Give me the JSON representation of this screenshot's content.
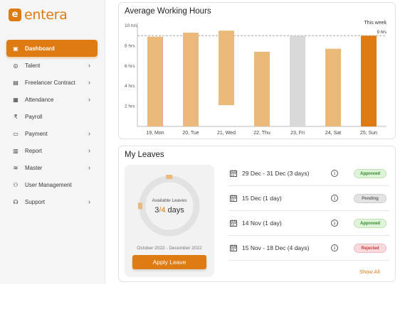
{
  "brand": {
    "name": "entera",
    "mark": "e",
    "accent": "#de7b12"
  },
  "sidebar": {
    "items": [
      {
        "label": "Dashboard",
        "icon": "dashboard-icon",
        "glyph": "▣",
        "active": true,
        "chevron": false
      },
      {
        "label": "Talent",
        "icon": "talent-icon",
        "glyph": "◎",
        "active": false,
        "chevron": true
      },
      {
        "label": "Freelancer Contract",
        "icon": "contract-icon",
        "glyph": "▤",
        "active": false,
        "chevron": true
      },
      {
        "label": "Attendance",
        "icon": "attendance-icon",
        "glyph": "▦",
        "active": false,
        "chevron": true
      },
      {
        "label": "Payroll",
        "icon": "rupee-icon",
        "glyph": "₹",
        "active": false,
        "chevron": false
      },
      {
        "label": "Payment",
        "icon": "payment-icon",
        "glyph": "▭",
        "active": false,
        "chevron": true
      },
      {
        "label": "Report",
        "icon": "report-icon",
        "glyph": "▥",
        "active": false,
        "chevron": true
      },
      {
        "label": "Master",
        "icon": "database-icon",
        "glyph": "≋",
        "active": false,
        "chevron": true
      },
      {
        "label": "User Management",
        "icon": "users-icon",
        "glyph": "⚇",
        "active": false,
        "chevron": false
      },
      {
        "label": "Support",
        "icon": "support-icon",
        "glyph": "☊",
        "active": false,
        "chevron": true
      }
    ],
    "chevron_glyph": "›"
  },
  "working_hours": {
    "title": "Average Working Hours",
    "this_week_label": "This week",
    "target_label": "9 hrs"
  },
  "chart_data": {
    "type": "bar",
    "title": "Average Working Hours",
    "categories": [
      "19, Mon",
      "20, Tue",
      "21, Wed",
      "22, Thu",
      "23, Fri",
      "24, Sat",
      "25, Sun"
    ],
    "series": [
      {
        "values": [
          {
            "start": 0,
            "end": 8.9,
            "color": "#ebb97a",
            "edge": "#f3a3a3"
          },
          {
            "start": 0,
            "end": 9.3,
            "color": "#ebb97a"
          },
          {
            "start": 2.1,
            "end": 9.5,
            "color": "#ebb97a"
          },
          {
            "start": 0,
            "end": 7.4,
            "color": "#ebb97a"
          },
          {
            "start": 0,
            "end": 9.0,
            "color": "#d9d9d9"
          },
          {
            "start": 0,
            "end": 7.7,
            "color": "#ebb97a"
          },
          {
            "start": 0,
            "end": 9.0,
            "color": "#de7b12"
          }
        ]
      }
    ],
    "yticks": [
      "10 hrs",
      "8 hrs",
      "6 hrs",
      "4 hrs",
      "2 hrs"
    ],
    "ytick_values": [
      10,
      8,
      6,
      4,
      2
    ],
    "ylim": [
      0,
      10
    ],
    "reference_line": 9,
    "grid": false
  },
  "leaves": {
    "title": "My Leaves",
    "available_label": "Available Leaves",
    "available_used": "3",
    "available_sep": "/",
    "available_total": "4",
    "available_unit": " days",
    "available_fraction": 0.75,
    "period": "October 2022 - December 2022",
    "apply_label": "Apply Leave",
    "info_glyph": "i",
    "rows": [
      {
        "dates": "29 Dec - 31 Dec  (3 days)",
        "status": "Approved",
        "kind": "approved"
      },
      {
        "dates": "15 Dec  (1 day)",
        "status": "Pending",
        "kind": "pending"
      },
      {
        "dates": "14 Nov  (1 day)",
        "status": "Approved",
        "kind": "approved"
      },
      {
        "dates": "15 Nov - 18 Dec  (4 days)",
        "status": "Rejected",
        "kind": "rejected"
      }
    ],
    "show_all_label": "Show All"
  }
}
